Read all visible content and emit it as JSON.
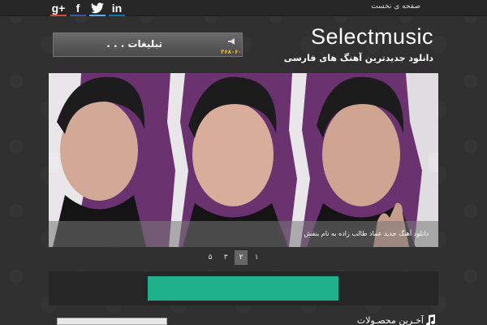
{
  "topbar": {
    "social": [
      {
        "label": "g+",
        "icon": "google-plus-icon"
      },
      {
        "label": "f",
        "icon": "facebook-icon"
      },
      {
        "label": "🐦",
        "icon": "twitter-icon"
      },
      {
        "label": "in",
        "icon": "linkedin-icon"
      }
    ],
    "home_label": "صفحه ی نخست"
  },
  "ad": {
    "title": "تبلیغات . . .",
    "phone": "۳۶۸۰۶۰"
  },
  "header": {
    "brand": "Selectmusic",
    "tagline": "دانلود جدیدترین آهنگ های فارسی"
  },
  "slider": {
    "caption": "دانلود آهنگ جدید عماد طالب زاده به نام بنفش",
    "prev_label": "‹",
    "next_label": "›"
  },
  "pagination": {
    "pages": [
      "۵",
      "۳",
      "۲",
      "۱"
    ],
    "active": "۲"
  },
  "colors": {
    "accent": "#1fb18c",
    "background": "#303030",
    "slide_purple": "#5e2c63"
  },
  "section": {
    "title": "آخـرین محصـولات"
  }
}
